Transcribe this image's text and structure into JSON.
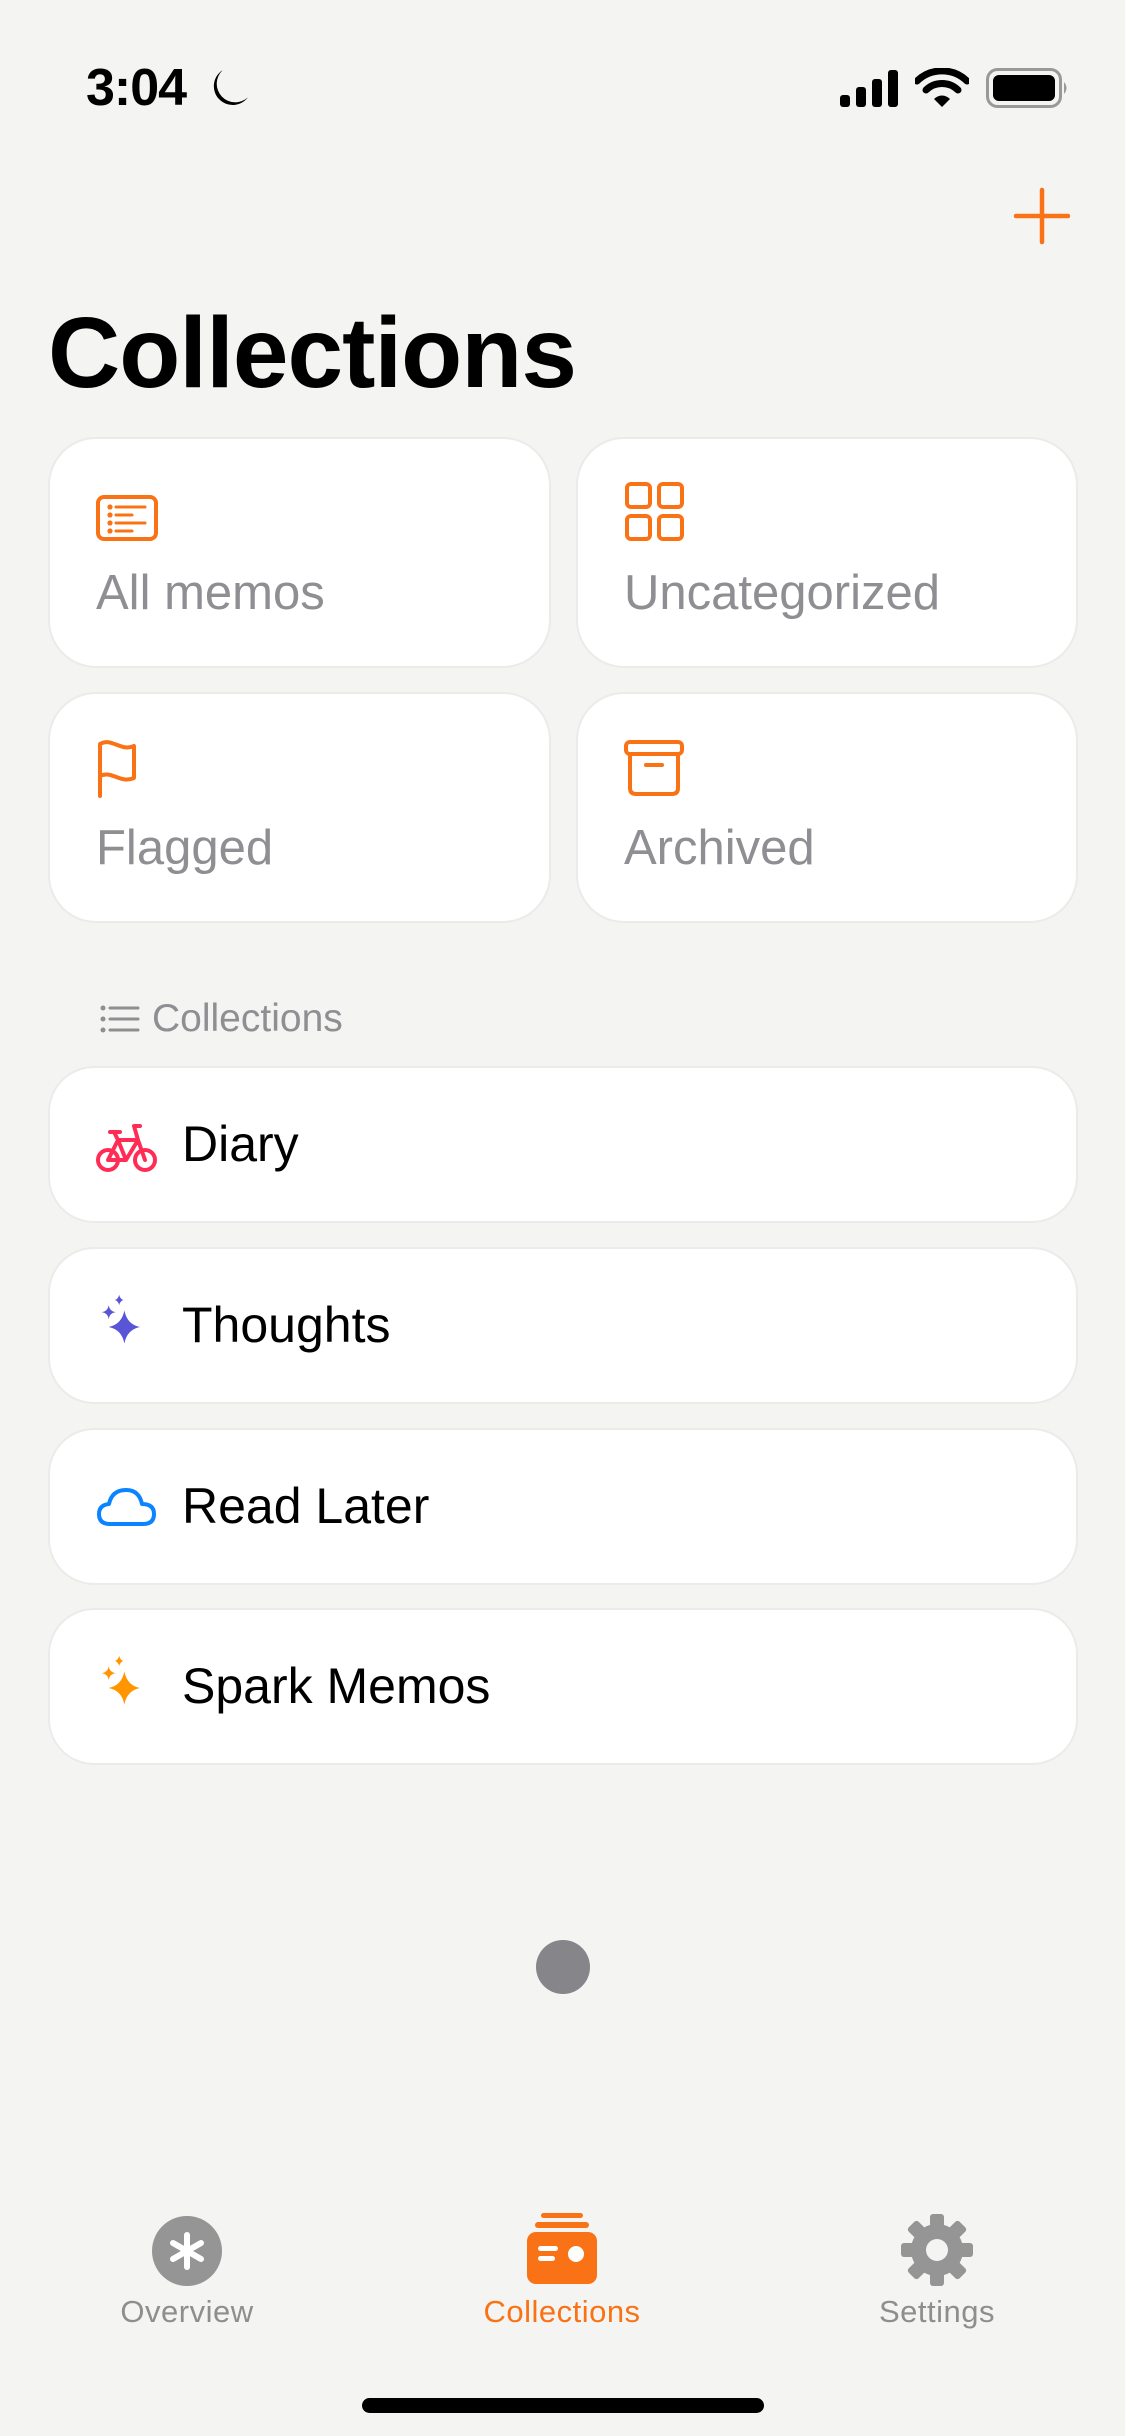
{
  "status_bar": {
    "time": "3:04",
    "focus_icon": "moon-icon",
    "signal_icon": "cellular-signal-icon",
    "wifi_icon": "wifi-icon",
    "battery_icon": "battery-full-icon"
  },
  "header": {
    "title": "Collections",
    "add_icon": "plus-icon"
  },
  "colors": {
    "accent": "#f97316",
    "background": "#f4f4f2",
    "card": "#ffffff",
    "secondary_text": "#8e8e93",
    "diary_icon": "#ff2d55",
    "thoughts_icon": "#5856d6",
    "read_later_icon": "#0a84ff",
    "spark_icon": "#ff9500",
    "tab_inactive": "#8e8e8e"
  },
  "smart_collections": [
    {
      "label": "All memos",
      "icon": "list-card-icon"
    },
    {
      "label": "Uncategorized",
      "icon": "grid-icon"
    },
    {
      "label": "Flagged",
      "icon": "flag-icon"
    },
    {
      "label": "Archived",
      "icon": "archive-box-icon"
    }
  ],
  "section": {
    "label": "Collections",
    "icon": "list-bullet-icon"
  },
  "collections": [
    {
      "label": "Diary",
      "icon": "bicycle-icon"
    },
    {
      "label": "Thoughts",
      "icon": "sparkles-icon"
    },
    {
      "label": "Read Later",
      "icon": "cloud-icon"
    },
    {
      "label": "Spark Memos",
      "icon": "sparkles-icon"
    }
  ],
  "tab_bar": {
    "tabs": [
      {
        "label": "Overview",
        "icon": "asterisk-circle-icon",
        "active": false
      },
      {
        "label": "Collections",
        "icon": "card-stack-icon",
        "active": true
      },
      {
        "label": "Settings",
        "icon": "gear-icon",
        "active": false
      }
    ]
  }
}
